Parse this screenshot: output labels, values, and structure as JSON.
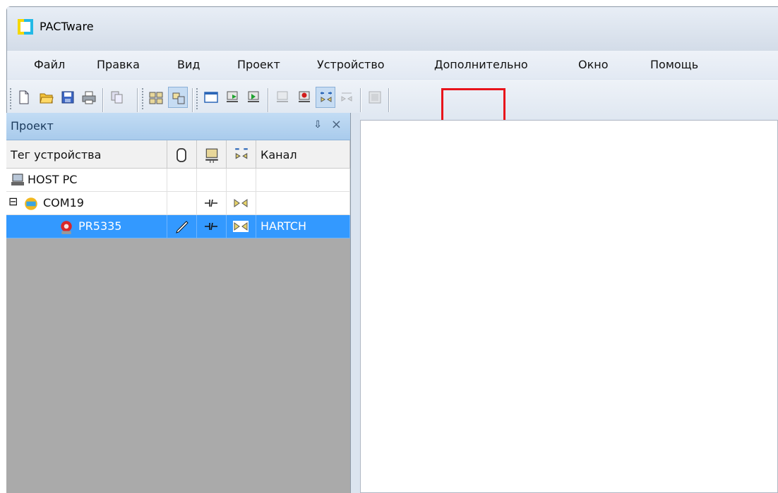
{
  "app": {
    "title": "PACTware"
  },
  "menu": [
    "Файл",
    "Правка",
    "Вид",
    "Проект",
    "Устройство",
    "Дополнительно",
    "Окно",
    "Помощь"
  ],
  "toolbar": {
    "icons": [
      "new-document-icon",
      "open-folder-icon",
      "save-icon",
      "print-icon",
      "copy-dropdown-icon",
      "project-network-icon",
      "device-catalog-icon",
      "window-icon",
      "connect-device-icon",
      "disconnect-device-icon",
      "upload-device-icon",
      "download-device-icon",
      "online-parameter-icon",
      "communication-icon",
      "offline-icon"
    ],
    "highlighted": "online-parameter-icon"
  },
  "panel": {
    "title": "Проект",
    "pin_glyph": "⇩",
    "close_glyph": "×",
    "columns": {
      "tag": "Тег устройства",
      "channel": "Канал"
    },
    "rows": [
      {
        "name": "HOST PC",
        "channel": ""
      },
      {
        "name": "COM19",
        "expand": "⊟",
        "channel": ""
      },
      {
        "name": "PR5335",
        "channel": "HARTCH",
        "selected": true
      }
    ]
  },
  "colors": {
    "selection": "#3399ff",
    "highlight": "#e8141b",
    "panel_header": "#b4d3f1"
  }
}
